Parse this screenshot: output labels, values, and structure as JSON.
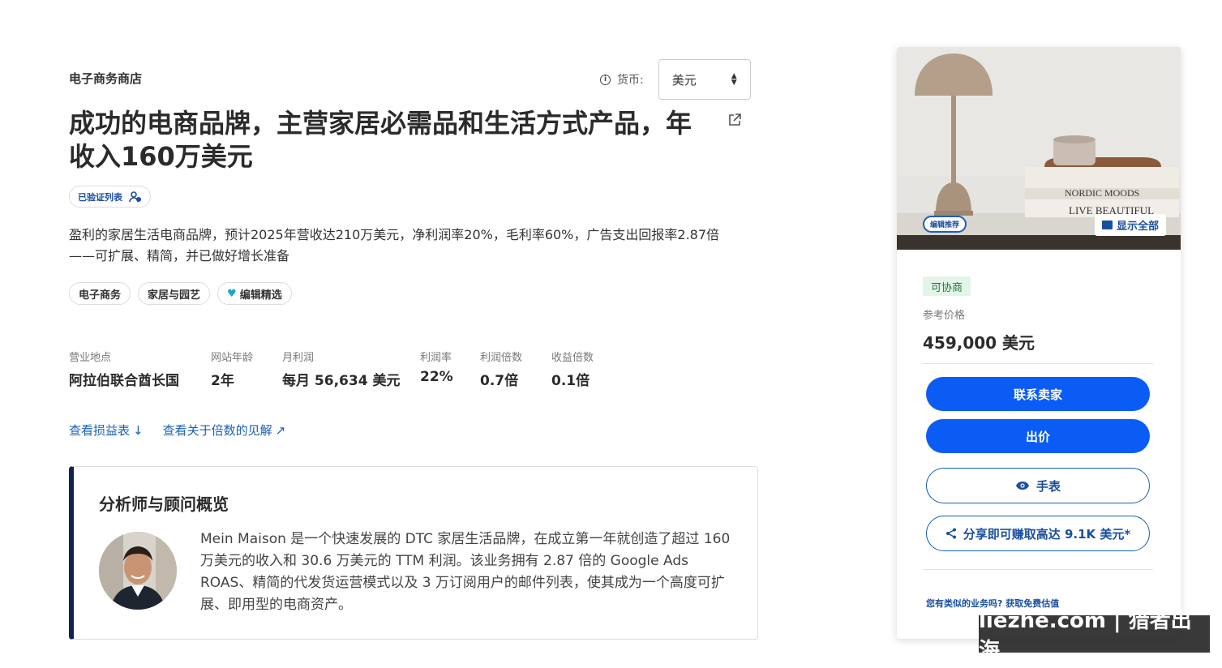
{
  "header": {
    "category": "电子商务商店",
    "currency_label": "货币:",
    "currency_value": "美元",
    "title": "成功的电商品牌，主营家居必需品和生活方式产品，年收入160万美元",
    "verified_badge": "已验证列表"
  },
  "description": "盈利的家居生活电商品牌，预计2025年营收达210万美元，净利润率20%，毛利率60%，广告支出回报率2.87倍——可扩展、精简，并已做好增长准备",
  "tags": [
    "电子商务",
    "家居与园艺",
    "编辑精选"
  ],
  "stats": [
    {
      "label": "营业地点",
      "value": "阿拉伯联合酋长国"
    },
    {
      "label": "网站年龄",
      "value": "2年"
    },
    {
      "label": "月利润",
      "value": "每月 56,634 美元"
    },
    {
      "label": "利润率",
      "value": "22%"
    },
    {
      "label": "利润倍数",
      "value": "0.7倍"
    },
    {
      "label": "收益倍数",
      "value": "0.1倍"
    }
  ],
  "links": {
    "pnl": "查看损益表",
    "multiples": "查看关于倍数的见解"
  },
  "analyst": {
    "heading": "分析师与顾问概览",
    "text": "Mein Maison 是一个快速发展的 DTC 家居生活品牌，在成立第一年就创造了超过 160 万美元的收入和 30.6 万美元的 TTM 利润。该业务拥有 2.87 倍的 Google Ads ROAS、精简的代发货运营模式以及 3 万订阅用户的邮件列表，使其成为一个高度可扩展、即用型的电商资产。"
  },
  "card": {
    "editor_badge": "编辑推荐",
    "show_all": "显示全部",
    "book_text_1": "NORDIC MOODS",
    "book_text_2": "LIVE BEAUTIFUL",
    "negotiable": "可协商",
    "ref_price_label": "参考价格",
    "price": "459,000 美元",
    "btn_contact": "联系卖家",
    "btn_offer": "出价",
    "btn_watch": "手表",
    "btn_share": "分享即可赚取高达 9.1K 美元*",
    "similar": "您有类似的业务吗? 获取免费估值"
  },
  "watermark": "liezhe.com | 猎者出海",
  "colors": {
    "primary_button": "#0a5cf5",
    "link": "#1a5fb4",
    "analyst_border": "#0f2250",
    "negotiable_bg": "#e3f5e8"
  }
}
